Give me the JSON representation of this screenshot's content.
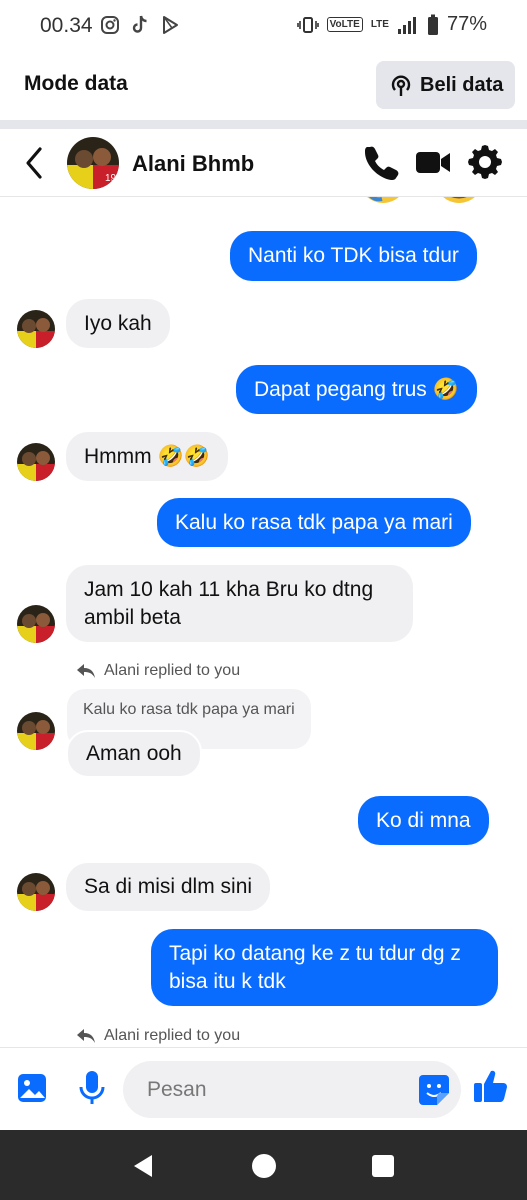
{
  "status_bar": {
    "time": "00.34",
    "battery": "77%",
    "volte": "VoLTE",
    "lte": "LTE"
  },
  "data_banner": {
    "label": "Mode data",
    "buy_button": "Beli data"
  },
  "chat_header": {
    "contact_name": "Alani Bhmb"
  },
  "messages": [
    {
      "dir": "out",
      "text": "Nanti ko TDK bisa tdur"
    },
    {
      "dir": "in",
      "text": "Iyo kah"
    },
    {
      "dir": "out",
      "text": "Dapat pegang trus 🤣"
    },
    {
      "dir": "in",
      "text": "Hmmm 🤣🤣"
    },
    {
      "dir": "out",
      "text": "Kalu ko rasa tdk papa ya mari"
    },
    {
      "dir": "in",
      "text": "Jam 10 kah 11 kha Bru ko dtng ambil beta"
    },
    {
      "dir": "note",
      "text": "Alani replied to you"
    },
    {
      "dir": "quote",
      "text": "Kalu ko rasa tdk papa ya mari"
    },
    {
      "dir": "in",
      "text": "Aman ooh"
    },
    {
      "dir": "out",
      "text": "Ko di mna"
    },
    {
      "dir": "in",
      "text": "Sa di misi dlm sini"
    },
    {
      "dir": "out",
      "text": "Tapi ko datang ke z tu tdur dg z bisa itu k tdk"
    },
    {
      "dir": "note",
      "text": "Alani replied to you"
    }
  ],
  "composer": {
    "placeholder": "Pesan"
  },
  "colors": {
    "accent": "#0a6cff",
    "incoming_bubble": "#f0f0f2",
    "nav_bar": "#2b2b2b"
  },
  "icons": {
    "back": "chevron-left-icon",
    "call": "phone-icon",
    "video": "video-camera-icon",
    "settings": "gear-icon",
    "gallery": "image-icon",
    "mic": "microphone-icon",
    "sticker": "sticker-icon",
    "like": "thumbs-up-icon",
    "reply": "reply-arrow-icon"
  }
}
